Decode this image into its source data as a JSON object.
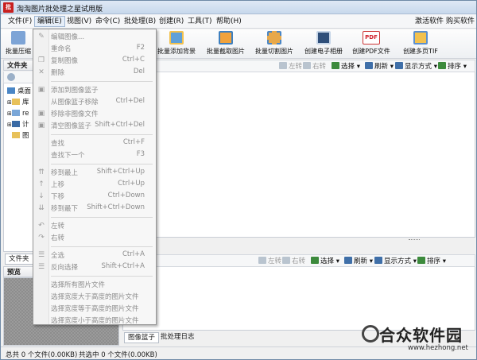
{
  "window": {
    "title": "淘淘图片批处理之星试用版",
    "app_icon_text": "批"
  },
  "menubar": {
    "items": [
      "文件(F)",
      "编辑(E)",
      "视图(V)",
      "命令(C)",
      "批处理(B)",
      "创建(R)",
      "工具(T)",
      "帮助(H)"
    ],
    "right_items": [
      "激活软件",
      "购买软件"
    ]
  },
  "toolbar": {
    "buttons": [
      "批量压缩",
      "批量添加背景",
      "批量截取图片",
      "批量切割图片",
      "创建电子相册",
      "创建PDF文件",
      "创建多页TIF"
    ],
    "pdf_badge": "PDF"
  },
  "left": {
    "folders_label": "文件夹",
    "tree": [
      "桌面",
      "库",
      "re",
      "计",
      "图"
    ],
    "files_tab": "文件夹",
    "preview_label": "预览"
  },
  "list_toolbar": {
    "left_turn": "左转",
    "right_turn": "右转",
    "select": "选择",
    "refresh": "刷新",
    "display": "显示方式",
    "sort": "排序"
  },
  "bottom_tabs": [
    "图像篮子",
    "批处理日志"
  ],
  "status": {
    "total": "总共 0 个文件(0.00KB)",
    "selected": "共选中 0 个文件(0.00KB)"
  },
  "edit_menu": {
    "items": [
      {
        "label": "编辑图像...",
        "shortcut": "",
        "icon": "✎"
      },
      {
        "label": "重命名",
        "shortcut": "F2",
        "icon": ""
      },
      {
        "label": "复制图像",
        "shortcut": "Ctrl+C",
        "icon": "❐"
      },
      {
        "label": "删除",
        "shortcut": "Del",
        "icon": "✕"
      },
      {
        "sep": true
      },
      {
        "label": "添加到图像篮子",
        "shortcut": "",
        "icon": "▣"
      },
      {
        "label": "从图像篮子移除",
        "shortcut": "Ctrl+Del",
        "icon": ""
      },
      {
        "label": "移除非图像文件",
        "shortcut": "",
        "icon": "▣"
      },
      {
        "label": "清空图像篮子",
        "shortcut": "Shift+Ctrl+Del",
        "icon": "▣"
      },
      {
        "sep": true
      },
      {
        "label": "查找",
        "shortcut": "Ctrl+F",
        "icon": ""
      },
      {
        "label": "查找下一个",
        "shortcut": "F3",
        "icon": ""
      },
      {
        "sep": true
      },
      {
        "label": "移到最上",
        "shortcut": "Shift+Ctrl+Up",
        "icon": "⇈"
      },
      {
        "label": "上移",
        "shortcut": "Ctrl+Up",
        "icon": "↑"
      },
      {
        "label": "下移",
        "shortcut": "Ctrl+Down",
        "icon": "↓"
      },
      {
        "label": "移到最下",
        "shortcut": "Shift+Ctrl+Down",
        "icon": "⇊"
      },
      {
        "sep": true
      },
      {
        "label": "左转",
        "shortcut": "",
        "icon": "↶"
      },
      {
        "label": "右转",
        "shortcut": "",
        "icon": "↷"
      },
      {
        "sep": true
      },
      {
        "label": "全选",
        "shortcut": "Ctrl+A",
        "icon": "☰"
      },
      {
        "label": "反向选择",
        "shortcut": "Shift+Ctrl+A",
        "icon": "☰"
      },
      {
        "sep": true
      },
      {
        "label": "选择所有图片文件",
        "shortcut": "",
        "icon": ""
      },
      {
        "label": "选择宽度大于高度的图片文件",
        "shortcut": "",
        "icon": ""
      },
      {
        "label": "选择宽度等于高度的图片文件",
        "shortcut": "",
        "icon": ""
      },
      {
        "label": "选择宽度小于高度的图片文件",
        "shortcut": "",
        "icon": ""
      }
    ]
  },
  "watermark": {
    "main": "合众软件园",
    "sub": "www.hezhong.net"
  },
  "colors": {
    "accent": "#3f6fa8",
    "menu_text_disabled": "#8d8d8d"
  }
}
